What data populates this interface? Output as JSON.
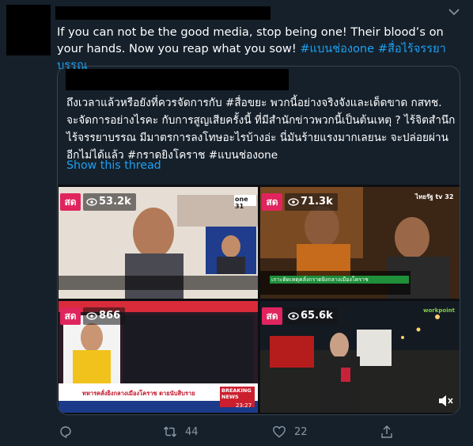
{
  "tweet": {
    "text_plain": "If you can not be the good media, stop being one! Their blood’s on your hands. Now you reap what you sow!",
    "hashtags": [
      "#แบนช่องone",
      "#สื่อไร้จรรยาบรรณ"
    ]
  },
  "quoted": {
    "text": "ถึงเวลาแล้วหรือยังที่ควรจัดการกับ #สื่อขยะ พวกนี้อย่างจริงจังและเด็ดขาด กสทช. จะจัดการอย่างไรคะ กับการสูญเสียครั้งนี้ ที่มีสำนักข่าวพวกนี้เป็นต้นเหตุ ? ไร้จิตสำนึก ไร้จรรยาบรรณ มีมาตรการลงโทษอะไรบ้างอ่ะ นี่มันร้ายแรงมากเลยนะ จะปล่อยผ่านอีกไม่ได้แล้ว #กราดยิงโคราช #แบนช่องone",
    "show_thread": "Show this thread",
    "media": [
      {
        "live": "สด",
        "views": "53.2k",
        "channel": "one 31"
      },
      {
        "live": "สด",
        "views": "71.3k",
        "channel": "ไทยรัฐ tv 32",
        "caption": "เกาะติดเหตุคลั่งกราดยิงกลางเมืองโคราช"
      },
      {
        "live": "สด",
        "views": "866",
        "caption": "ทหารคลั่งยิงกลางเมืองโคราช ตายนับสิบราย",
        "badge": "BREAKING NEWS",
        "time": "23:27"
      },
      {
        "live": "สด",
        "views": "65.6k",
        "channel": "workpoint"
      }
    ]
  },
  "actions": {
    "retweets": "44",
    "likes": "22"
  },
  "colors": {
    "background": "#15202b",
    "accent": "#1da1f2",
    "muted": "#8899a6",
    "live": "#e0245e"
  }
}
